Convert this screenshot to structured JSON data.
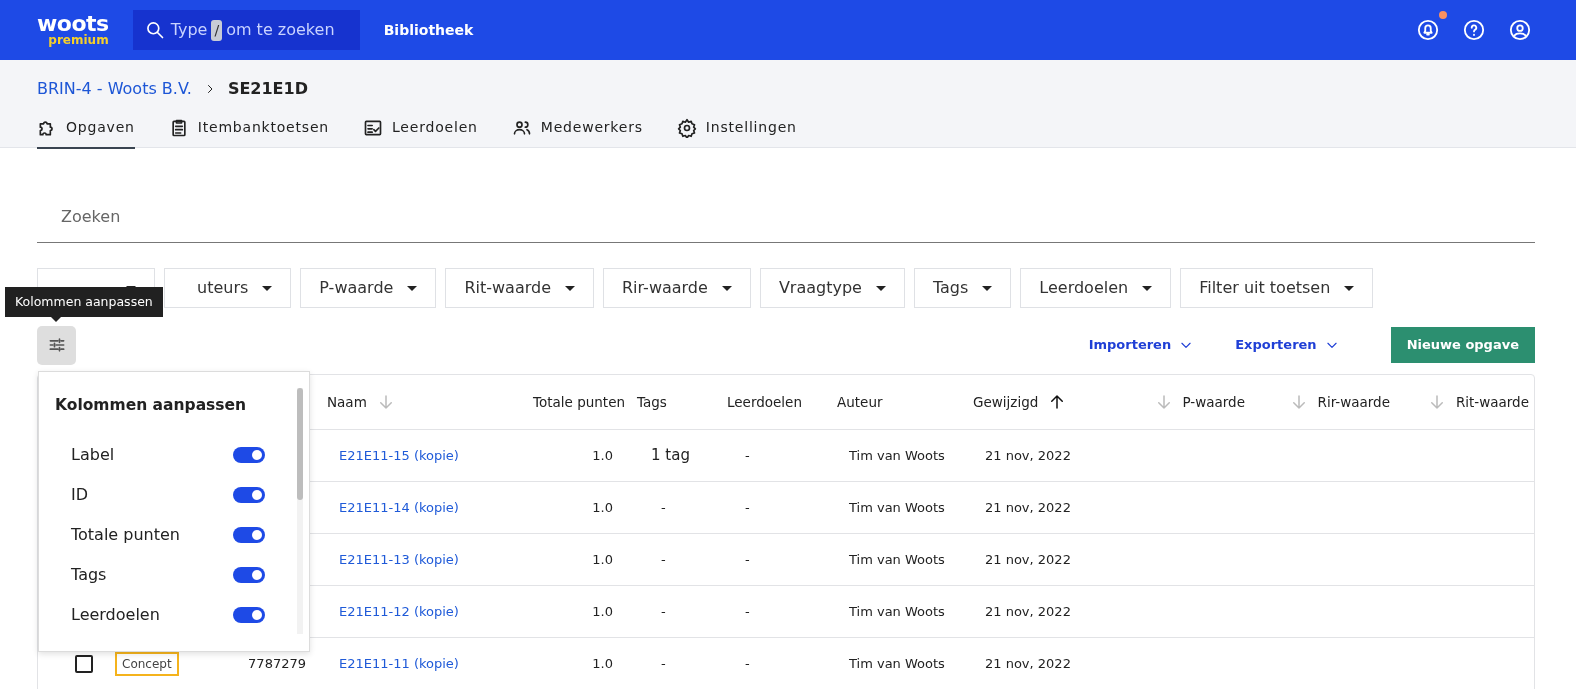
{
  "navbar": {
    "logo": "woots",
    "logo_sub": "premium",
    "search": {
      "before": "Type",
      "key": "/",
      "after": "om te zoeken"
    },
    "link": "Bibliotheek",
    "has_notification": true
  },
  "breadcrumb": [
    {
      "label": "BRIN-4 - Woots B.V."
    },
    {
      "label": "SE21E1D"
    }
  ],
  "tabs": [
    {
      "label": "Opgaven",
      "selected": true
    },
    {
      "label": "Itembanktoetsen",
      "selected": false
    },
    {
      "label": "Leerdoelen",
      "selected": false
    },
    {
      "label": "Medewerkers",
      "selected": false
    },
    {
      "label": "Instellingen",
      "selected": false
    }
  ],
  "search_field": {
    "placeholder": "Zoeken"
  },
  "filters": [
    {
      "covered": true
    },
    {
      "label": "uteurs"
    },
    {
      "label": "P-waarde"
    },
    {
      "label": "Rit-waarde"
    },
    {
      "label": "Rir-waarde"
    },
    {
      "label": "Vraagtype"
    },
    {
      "label": "Tags"
    },
    {
      "label": "Leerdoelen"
    },
    {
      "label": "Filter uit toetsen"
    }
  ],
  "tooltip": "Kolommen aanpassen",
  "actions": {
    "import": "Importeren",
    "export": "Exporteren",
    "create": "Nieuwe opgave"
  },
  "table": {
    "columns": [
      {
        "label": "Naam",
        "sortable": true,
        "sorted": false
      },
      {
        "label": "Totale punten",
        "sortable": false
      },
      {
        "label": "Tags",
        "sortable": false
      },
      {
        "label": "Leerdoelen",
        "sortable": false
      },
      {
        "label": "Auteur",
        "sortable": false
      },
      {
        "label": "Gewijzigd",
        "sortable": true,
        "sorted": true
      },
      {
        "label": "P-waarde",
        "sortable": true,
        "sorted": false
      },
      {
        "label": "Rir-waarde",
        "sortable": true,
        "sorted": false
      },
      {
        "label": "Rit-waarde",
        "sortable": true,
        "sorted": false
      }
    ],
    "rows": [
      {
        "name": "E21E11-15 (kopie)",
        "points": "1.0",
        "tags": "1 tag",
        "goals": "-",
        "author": "Tim van Woots",
        "modified": "21 nov, 2022"
      },
      {
        "name": "E21E11-14 (kopie)",
        "points": "1.0",
        "tags": "-",
        "goals": "-",
        "author": "Tim van Woots",
        "modified": "21 nov, 2022"
      },
      {
        "name": "E21E11-13 (kopie)",
        "points": "1.0",
        "tags": "-",
        "goals": "-",
        "author": "Tim van Woots",
        "modified": "21 nov, 2022"
      },
      {
        "name": "E21E11-12 (kopie)",
        "points": "1.0",
        "tags": "-",
        "goals": "-",
        "author": "Tim van Woots",
        "modified": "21 nov, 2022"
      },
      {
        "checked": false,
        "status": "Concept",
        "id": "7787279",
        "name": "E21E11-11 (kopie)",
        "points": "1.0",
        "tags": "-",
        "goals": "-",
        "author": "Tim van Woots",
        "modified": "21 nov, 2022"
      }
    ]
  },
  "column_menu": {
    "title": "Kolommen aanpassen",
    "items": [
      {
        "label": "Label",
        "on": true
      },
      {
        "label": "ID",
        "on": true
      },
      {
        "label": "Totale punten",
        "on": true
      },
      {
        "label": "Tags",
        "on": true
      },
      {
        "label": "Leerdoelen",
        "on": true
      }
    ]
  }
}
